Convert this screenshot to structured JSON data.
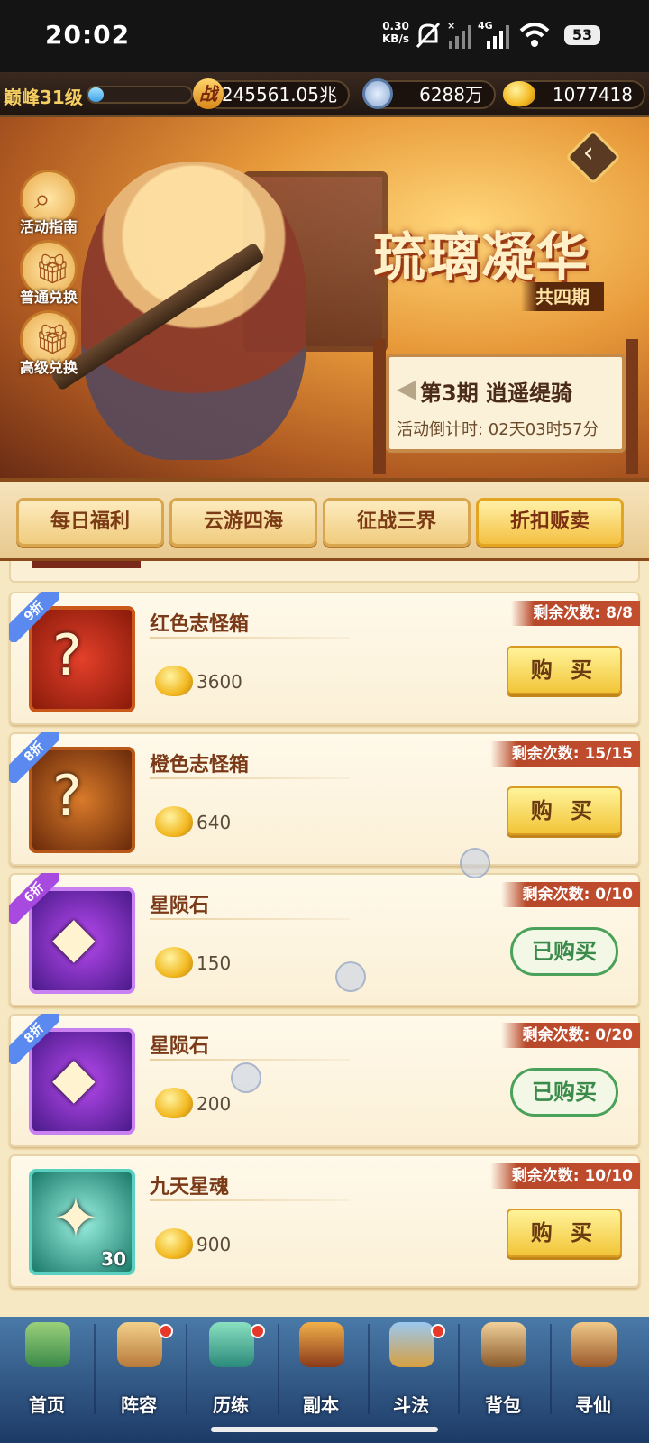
{
  "status_bar": {
    "time": "20:02",
    "speed_value": "0.30",
    "speed_unit": "KB/s",
    "network": "4G",
    "battery": "53"
  },
  "resources": {
    "level": "巅峰31级",
    "level_progress": 0.15,
    "power_icon": "战",
    "power": "245561.05兆",
    "copper": "6288万",
    "gold": "1077418"
  },
  "banner": {
    "title": "琉璃凝华",
    "subtitle": "共四期",
    "period": "第3期  逍遥缇骑",
    "countdown": "活动倒计时: 02天03时57分",
    "side_buttons": [
      {
        "label": "活动指南",
        "icon": "magnifier-icon"
      },
      {
        "label": "普通兑换",
        "icon": "gift-box-icon"
      },
      {
        "label": "高级兑换",
        "icon": "gift-box-icon"
      }
    ]
  },
  "tabs": [
    {
      "label": "每日福利",
      "active": false
    },
    {
      "label": "云游四海",
      "active": false
    },
    {
      "label": "征战三界",
      "active": false
    },
    {
      "label": "折扣贩卖",
      "active": true
    }
  ],
  "items": [
    {
      "name": "红色志怪箱",
      "discount": "9折",
      "price": "3600",
      "remaining": "剩余次数: 8/8",
      "button": "购 买",
      "bought": false,
      "qty": ""
    },
    {
      "name": "橙色志怪箱",
      "discount": "8折",
      "price": "640",
      "remaining": "剩余次数: 15/15",
      "button": "购 买",
      "bought": false,
      "qty": ""
    },
    {
      "name": "星陨石",
      "discount": "6折",
      "price": "150",
      "remaining": "剩余次数: 0/10",
      "button": "已购买",
      "bought": true,
      "qty": ""
    },
    {
      "name": "星陨石",
      "discount": "8折",
      "price": "200",
      "remaining": "剩余次数: 0/20",
      "button": "已购买",
      "bought": true,
      "qty": ""
    },
    {
      "name": "九天星魂",
      "discount": "",
      "price": "900",
      "remaining": "剩余次数: 10/10",
      "button": "购 买",
      "bought": false,
      "qty": "30"
    }
  ],
  "nav": [
    {
      "label": "首页",
      "badge": false
    },
    {
      "label": "阵容",
      "badge": true
    },
    {
      "label": "历练",
      "badge": true
    },
    {
      "label": "副本",
      "badge": false
    },
    {
      "label": "斗法",
      "badge": true
    },
    {
      "label": "背包",
      "badge": false
    },
    {
      "label": "寻仙",
      "badge": false
    }
  ],
  "colors": {
    "accent_gold": "#f2c538",
    "bought_green": "#3a8a4a",
    "remain_red": "#c24e2e",
    "nav_blue": "#2a4f80"
  }
}
